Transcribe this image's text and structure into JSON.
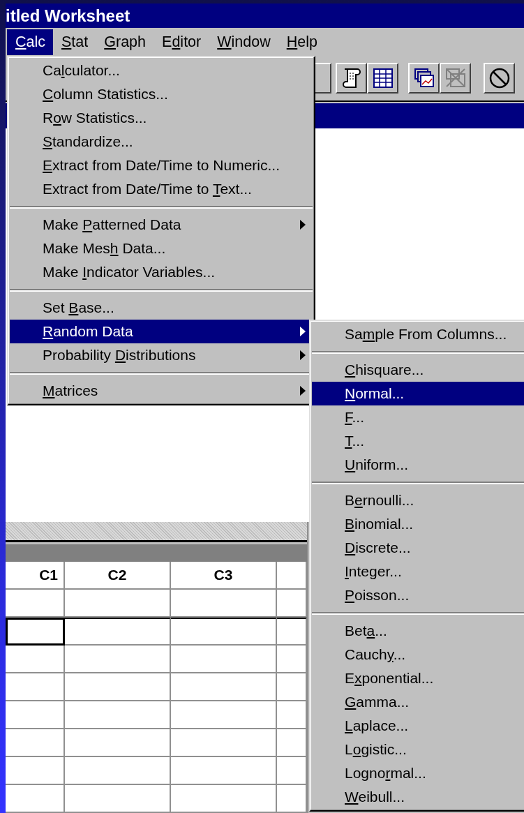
{
  "window": {
    "title": "itled Worksheet"
  },
  "menu_bar": [
    {
      "key": "C",
      "after": "alc",
      "selected": true
    },
    {
      "key": "S",
      "after": "tat",
      "selected": false
    },
    {
      "key": "G",
      "after": "raph",
      "selected": false
    },
    {
      "before": "E",
      "key": "d",
      "after": "itor",
      "selected": false
    },
    {
      "key": "W",
      "after": "indow",
      "selected": false
    },
    {
      "key": "H",
      "after": "elp",
      "selected": false
    }
  ],
  "calc_menu": {
    "items": [
      {
        "kind": "item",
        "before": "Ca",
        "key": "l",
        "after": "culator...",
        "submenu": false,
        "selected": false
      },
      {
        "kind": "item",
        "key": "C",
        "after": "olumn Statistics...",
        "submenu": false,
        "selected": false
      },
      {
        "kind": "item",
        "before": "R",
        "key": "o",
        "after": "w Statistics...",
        "submenu": false,
        "selected": false
      },
      {
        "kind": "item",
        "key": "S",
        "after": "tandardize...",
        "submenu": false,
        "selected": false
      },
      {
        "kind": "item",
        "key": "E",
        "after": "xtract from Date/Time to Numeric...",
        "submenu": false,
        "selected": false
      },
      {
        "kind": "item",
        "before": "Extract from Date/Time to ",
        "key": "T",
        "after": "ext...",
        "submenu": false,
        "selected": false
      },
      {
        "kind": "separator"
      },
      {
        "kind": "item",
        "before": "Make ",
        "key": "P",
        "after": "atterned Data",
        "submenu": true,
        "selected": false
      },
      {
        "kind": "item",
        "before": "Make Mes",
        "key": "h",
        "after": " Data...",
        "submenu": false,
        "selected": false
      },
      {
        "kind": "item",
        "before": "Make ",
        "key": "I",
        "after": "ndicator Variables...",
        "submenu": false,
        "selected": false
      },
      {
        "kind": "separator"
      },
      {
        "kind": "item",
        "before": "Set ",
        "key": "B",
        "after": "ase...",
        "submenu": false,
        "selected": false
      },
      {
        "kind": "item",
        "key": "R",
        "after": "andom Data",
        "submenu": true,
        "selected": true
      },
      {
        "kind": "item",
        "before": "Probability ",
        "key": "D",
        "after": "istributions",
        "submenu": true,
        "selected": false
      },
      {
        "kind": "separator"
      },
      {
        "kind": "item",
        "key": "M",
        "after": "atrices",
        "submenu": true,
        "selected": false
      }
    ]
  },
  "random_data_menu": {
    "items": [
      {
        "kind": "item",
        "before": "Sa",
        "key": "m",
        "after": "ple From Columns...",
        "selected": false
      },
      {
        "kind": "separator"
      },
      {
        "kind": "item",
        "key": "C",
        "after": "hisquare...",
        "selected": false
      },
      {
        "kind": "item",
        "key": "N",
        "after": "ormal...",
        "selected": true
      },
      {
        "kind": "item",
        "key": "F",
        "after": "...",
        "selected": false
      },
      {
        "kind": "item",
        "key": "T",
        "after": "...",
        "selected": false
      },
      {
        "kind": "item",
        "key": "U",
        "after": "niform...",
        "selected": false
      },
      {
        "kind": "separator"
      },
      {
        "kind": "item",
        "before": "B",
        "key": "e",
        "after": "rnoulli...",
        "selected": false
      },
      {
        "kind": "item",
        "key": "B",
        "after": "inomial...",
        "selected": false
      },
      {
        "kind": "item",
        "key": "D",
        "after": "iscrete...",
        "selected": false
      },
      {
        "kind": "item",
        "key": "I",
        "after": "nteger...",
        "selected": false
      },
      {
        "kind": "item",
        "key": "P",
        "after": "oisson...",
        "selected": false
      },
      {
        "kind": "separator"
      },
      {
        "kind": "item",
        "before": "Bet",
        "key": "a",
        "after": "...",
        "selected": false
      },
      {
        "kind": "item",
        "before": "Cauch",
        "key": "y",
        "after": "...",
        "selected": false
      },
      {
        "kind": "item",
        "before": "E",
        "key": "x",
        "after": "ponential...",
        "selected": false
      },
      {
        "kind": "item",
        "key": "G",
        "after": "amma...",
        "selected": false
      },
      {
        "kind": "item",
        "key": "L",
        "after": "aplace...",
        "selected": false
      },
      {
        "kind": "item",
        "before": "L",
        "key": "o",
        "after": "gistic...",
        "selected": false
      },
      {
        "kind": "item",
        "before": "Logno",
        "key": "r",
        "after": "mal...",
        "selected": false
      },
      {
        "kind": "item",
        "key": "W",
        "after": "eibull...",
        "selected": false
      }
    ]
  },
  "worksheet": {
    "columns": [
      "C1",
      "C2",
      "C3"
    ],
    "rows": [
      {
        "selected": false
      },
      {
        "selected": true
      },
      {
        "selected": false
      },
      {
        "selected": false
      },
      {
        "selected": false
      },
      {
        "selected": false
      },
      {
        "selected": false
      },
      {
        "selected": false
      }
    ]
  }
}
